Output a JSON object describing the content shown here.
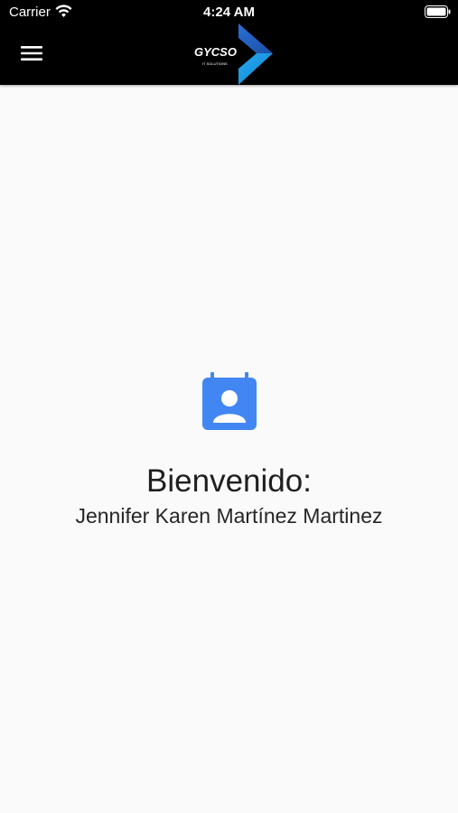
{
  "status_bar": {
    "carrier": "Carrier",
    "time": "4:24 AM",
    "wifi_icon": "wifi-icon",
    "battery_icon": "battery-icon"
  },
  "app_bar": {
    "menu_icon": "hamburger-menu-icon",
    "logo_text": "GYCSO",
    "logo_subtext": "IT SOLUTIONS",
    "background": "#000000"
  },
  "welcome": {
    "icon": "contact-calendar-icon",
    "icon_color": "#4286f4",
    "title": "Bienvenido:",
    "user_name": "Jennifer Karen Martínez Martinez"
  }
}
